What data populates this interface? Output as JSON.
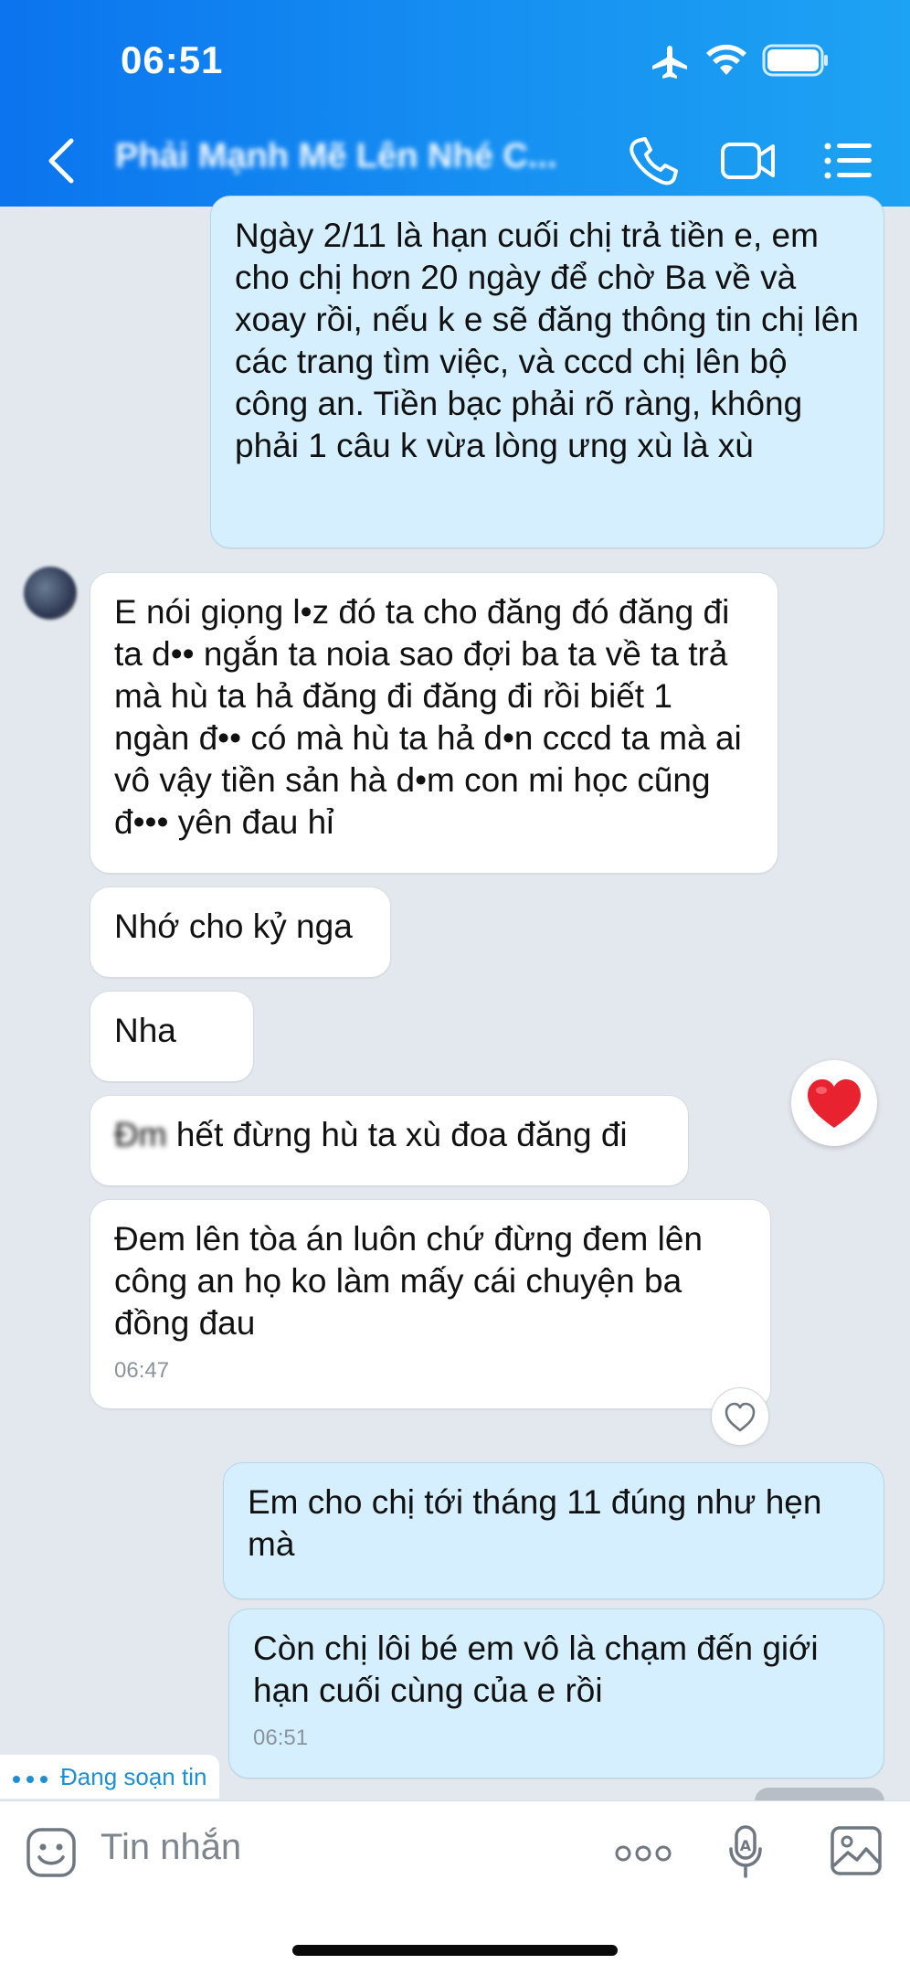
{
  "status_bar": {
    "time": "06:51"
  },
  "header": {
    "title": "Phải Mạnh Mẽ Lên Nhé C..."
  },
  "messages": [
    {
      "dir": "out",
      "text": "Ngày 2/11 là hạn cuối chị trả tiền e, em cho chị hơn 20 ngày để chờ Ba về và xoay rồi, nếu k e sẽ đăng thông tin chị lên các trang tìm việc, và cccd chị lên bộ công an. Tiền bạc phải rõ ràng, không phải 1 câu k vừa lòng ưng xù là xù"
    },
    {
      "dir": "in",
      "text": "E nói giọng l•z đó ta cho đăng đó đăng đi ta d•• ngắn ta noia sao đợi ba ta về ta trả mà hù ta hả đăng đi đăng đi rồi biết 1 ngàn đ•• có mà hù ta hả d•n cccd ta mà ai vô vậy tiền sản hà d•m con mi học cũng đ••• yên đau hỉ"
    },
    {
      "dir": "in",
      "text": "Nhớ cho kỷ nga"
    },
    {
      "dir": "in",
      "text": "Nha"
    },
    {
      "dir": "in",
      "censored": "Đm",
      "text": " hết đừng hù ta xù đoa đăng đi",
      "reaction": "heart"
    },
    {
      "dir": "in",
      "text": "Đem lên tòa án luôn chứ đừng đem lên công an họ ko làm mấy cái chuyện ba đồng đau",
      "time": "06:47"
    },
    {
      "dir": "out",
      "text": "Em cho chị tới tháng 11 đúng như hẹn mà"
    },
    {
      "dir": "out",
      "text": "Còn chị lôi bé em vô là chạm đến giới hạn cuối cùng của e rồi",
      "time": "06:51"
    }
  ],
  "typing_indicator": {
    "label": "Đang soạn tin"
  },
  "input": {
    "placeholder": "Tin nhắn"
  },
  "colors": {
    "header_start": "#0b74ee",
    "header_end": "#1da3f3",
    "outgoing_bubble": "#d5efff",
    "incoming_bubble": "#ffffff",
    "heart": "#e8222f"
  }
}
